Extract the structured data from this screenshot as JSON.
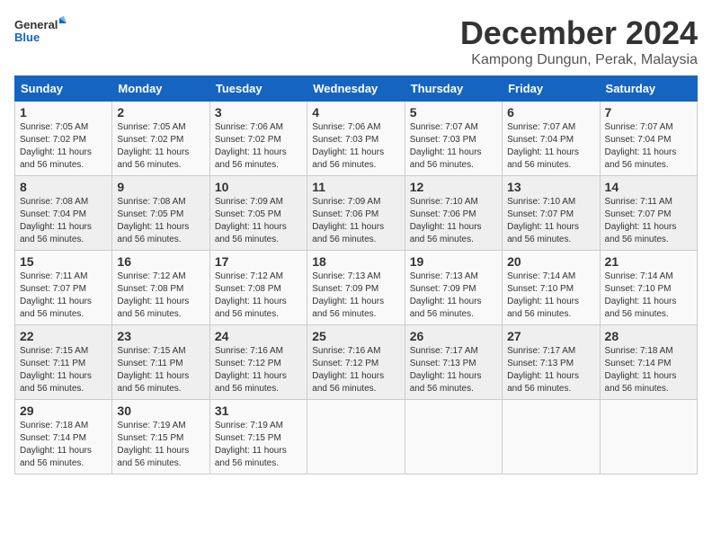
{
  "logo": {
    "line1": "General",
    "line2": "Blue"
  },
  "title": "December 2024",
  "subtitle": "Kampong Dungun, Perak, Malaysia",
  "days_of_week": [
    "Sunday",
    "Monday",
    "Tuesday",
    "Wednesday",
    "Thursday",
    "Friday",
    "Saturday"
  ],
  "weeks": [
    [
      {
        "day": 1,
        "rise": "7:05 AM",
        "set": "7:02 PM",
        "daylight": "11 hours and 56 minutes."
      },
      {
        "day": 2,
        "rise": "7:05 AM",
        "set": "7:02 PM",
        "daylight": "11 hours and 56 minutes."
      },
      {
        "day": 3,
        "rise": "7:06 AM",
        "set": "7:02 PM",
        "daylight": "11 hours and 56 minutes."
      },
      {
        "day": 4,
        "rise": "7:06 AM",
        "set": "7:03 PM",
        "daylight": "11 hours and 56 minutes."
      },
      {
        "day": 5,
        "rise": "7:07 AM",
        "set": "7:03 PM",
        "daylight": "11 hours and 56 minutes."
      },
      {
        "day": 6,
        "rise": "7:07 AM",
        "set": "7:04 PM",
        "daylight": "11 hours and 56 minutes."
      },
      {
        "day": 7,
        "rise": "7:07 AM",
        "set": "7:04 PM",
        "daylight": "11 hours and 56 minutes."
      }
    ],
    [
      {
        "day": 8,
        "rise": "7:08 AM",
        "set": "7:04 PM",
        "daylight": "11 hours and 56 minutes."
      },
      {
        "day": 9,
        "rise": "7:08 AM",
        "set": "7:05 PM",
        "daylight": "11 hours and 56 minutes."
      },
      {
        "day": 10,
        "rise": "7:09 AM",
        "set": "7:05 PM",
        "daylight": "11 hours and 56 minutes."
      },
      {
        "day": 11,
        "rise": "7:09 AM",
        "set": "7:06 PM",
        "daylight": "11 hours and 56 minutes."
      },
      {
        "day": 12,
        "rise": "7:10 AM",
        "set": "7:06 PM",
        "daylight": "11 hours and 56 minutes."
      },
      {
        "day": 13,
        "rise": "7:10 AM",
        "set": "7:07 PM",
        "daylight": "11 hours and 56 minutes."
      },
      {
        "day": 14,
        "rise": "7:11 AM",
        "set": "7:07 PM",
        "daylight": "11 hours and 56 minutes."
      }
    ],
    [
      {
        "day": 15,
        "rise": "7:11 AM",
        "set": "7:07 PM",
        "daylight": "11 hours and 56 minutes."
      },
      {
        "day": 16,
        "rise": "7:12 AM",
        "set": "7:08 PM",
        "daylight": "11 hours and 56 minutes."
      },
      {
        "day": 17,
        "rise": "7:12 AM",
        "set": "7:08 PM",
        "daylight": "11 hours and 56 minutes."
      },
      {
        "day": 18,
        "rise": "7:13 AM",
        "set": "7:09 PM",
        "daylight": "11 hours and 56 minutes."
      },
      {
        "day": 19,
        "rise": "7:13 AM",
        "set": "7:09 PM",
        "daylight": "11 hours and 56 minutes."
      },
      {
        "day": 20,
        "rise": "7:14 AM",
        "set": "7:10 PM",
        "daylight": "11 hours and 56 minutes."
      },
      {
        "day": 21,
        "rise": "7:14 AM",
        "set": "7:10 PM",
        "daylight": "11 hours and 56 minutes."
      }
    ],
    [
      {
        "day": 22,
        "rise": "7:15 AM",
        "set": "7:11 PM",
        "daylight": "11 hours and 56 minutes."
      },
      {
        "day": 23,
        "rise": "7:15 AM",
        "set": "7:11 PM",
        "daylight": "11 hours and 56 minutes."
      },
      {
        "day": 24,
        "rise": "7:16 AM",
        "set": "7:12 PM",
        "daylight": "11 hours and 56 minutes."
      },
      {
        "day": 25,
        "rise": "7:16 AM",
        "set": "7:12 PM",
        "daylight": "11 hours and 56 minutes."
      },
      {
        "day": 26,
        "rise": "7:17 AM",
        "set": "7:13 PM",
        "daylight": "11 hours and 56 minutes."
      },
      {
        "day": 27,
        "rise": "7:17 AM",
        "set": "7:13 PM",
        "daylight": "11 hours and 56 minutes."
      },
      {
        "day": 28,
        "rise": "7:18 AM",
        "set": "7:14 PM",
        "daylight": "11 hours and 56 minutes."
      }
    ],
    [
      {
        "day": 29,
        "rise": "7:18 AM",
        "set": "7:14 PM",
        "daylight": "11 hours and 56 minutes."
      },
      {
        "day": 30,
        "rise": "7:19 AM",
        "set": "7:15 PM",
        "daylight": "11 hours and 56 minutes."
      },
      {
        "day": 31,
        "rise": "7:19 AM",
        "set": "7:15 PM",
        "daylight": "11 hours and 56 minutes."
      },
      null,
      null,
      null,
      null
    ]
  ]
}
